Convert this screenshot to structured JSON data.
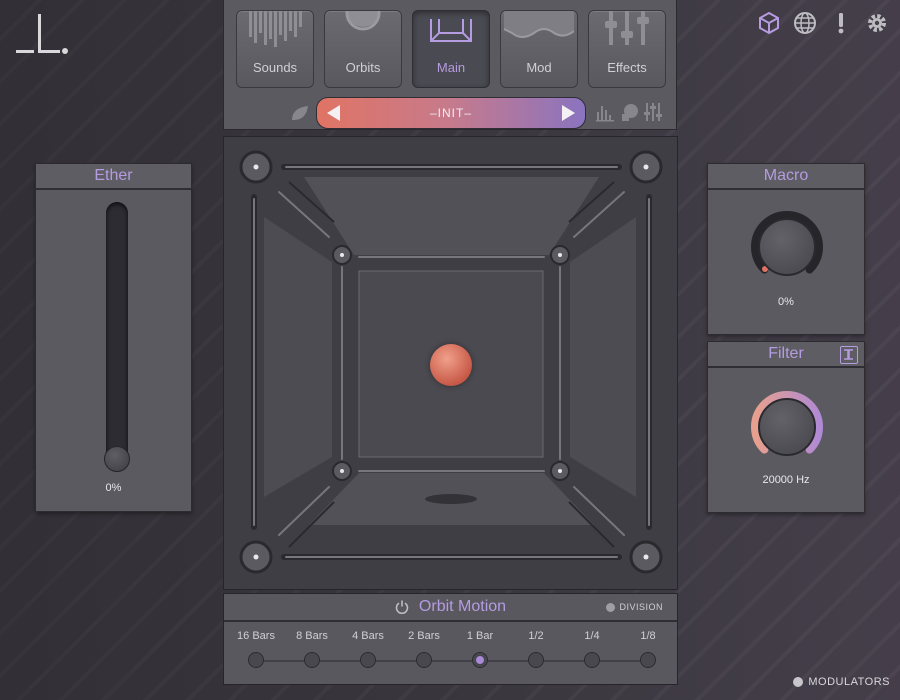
{
  "nav": {
    "tabs": [
      {
        "label": "Sounds",
        "icon": "waveform-icon"
      },
      {
        "label": "Orbits",
        "icon": "orbit-icon"
      },
      {
        "label": "Main",
        "icon": "cube-icon",
        "active": true
      },
      {
        "label": "Mod",
        "icon": "wave-icon"
      },
      {
        "label": "Effects",
        "icon": "sliders-icon"
      }
    ],
    "preset": "–INIT–"
  },
  "top_icons": [
    "cube-icon",
    "globe-icon",
    "alert-icon",
    "gear-icon"
  ],
  "ether": {
    "title": "Ether",
    "value": "0%",
    "level": 0
  },
  "macro": {
    "title": "Macro",
    "value": "0%",
    "level": 0
  },
  "filter": {
    "title": "Filter",
    "value": "20000 Hz",
    "level": 1
  },
  "orbit_motion": {
    "title": "Orbit Motion",
    "division_label": "DIVISION",
    "divisions": [
      "16 Bars",
      "8 Bars",
      "4 Bars",
      "2 Bars",
      "1 Bar",
      "1/2",
      "1/4",
      "1/8"
    ],
    "selected": "1 Bar"
  },
  "modulators_label": "MODULATORS",
  "colors": {
    "accent": "#b59be0",
    "preset_left": "#e07464",
    "preset_right": "#8a74c0",
    "orb": "#d8705c"
  }
}
